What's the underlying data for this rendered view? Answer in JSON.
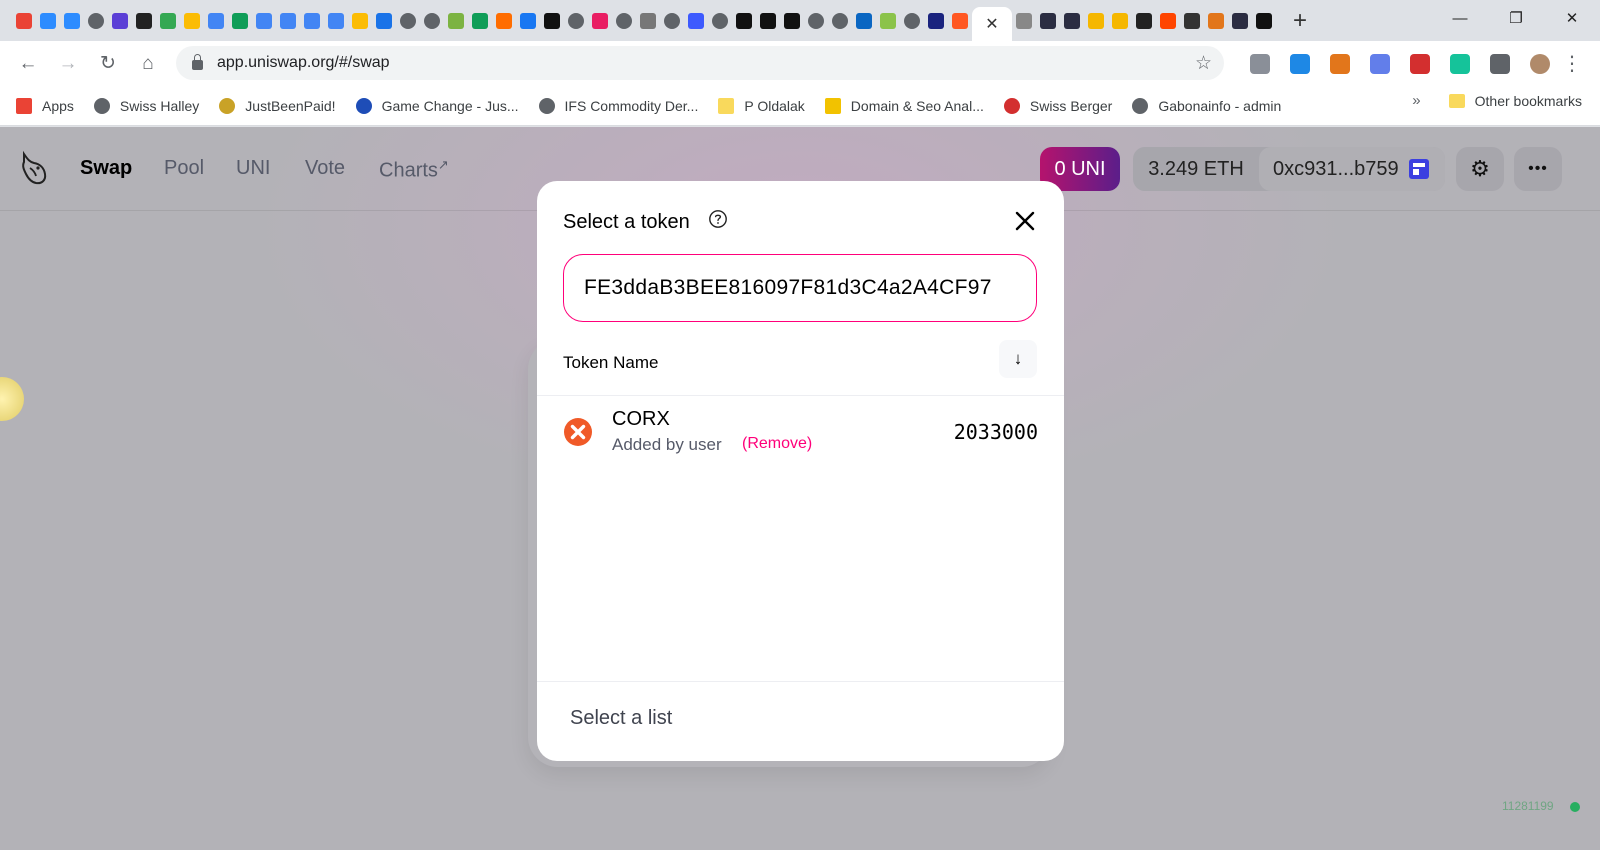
{
  "browser": {
    "tabs": {
      "favicon_colors": [
        "#ea4335",
        "#2d8cff",
        "#2d8cff",
        "#5f6368",
        "#5b3fd6",
        "#222222",
        "#34a853",
        "#fbbc04",
        "#4285f4",
        "#0f9d58",
        "#4285f4",
        "#4285f4",
        "#4285f4",
        "#4285f4",
        "#fbbc04",
        "#1a73e8",
        "#5f6368",
        "#5f6368",
        "#7cb342",
        "#0f9d58",
        "#ff6d00",
        "#1877f2",
        "#111111",
        "#5f6368",
        "#e91e63",
        "#5f6368",
        "#777777",
        "#5f6368",
        "#3d5afe",
        "#5f6368",
        "#111111",
        "#111111",
        "#111111",
        "#5f6368",
        "#5f6368",
        "#0a66c2",
        "#8bc34a",
        "#5f6368",
        "#1a237e",
        "#ff5722"
      ],
      "active_close": "✕",
      "after_colors": [
        "#888888",
        "#2b2d42",
        "#2b2d42",
        "#f5b700",
        "#f5b700",
        "#222222",
        "#ff4500",
        "#333333",
        "#e2761b",
        "#2b2d42",
        "#111111"
      ],
      "new_tab": "+"
    },
    "window": {
      "minimize": "—",
      "restore": "❐",
      "close": "✕"
    },
    "nav": {
      "back": "←",
      "forward": "→",
      "reload": "↻",
      "home": "⌂"
    },
    "url": "app.uniswap.org/#/swap",
    "star": "☆",
    "extensions": [
      "#8a8f98",
      "#1e88e5",
      "#e2761b",
      "#627eea",
      "#d32f2f",
      "#15c39a",
      "#5f6368",
      "#b08a6a"
    ],
    "menu": "⋮",
    "bookmarks": [
      {
        "label": "Apps",
        "color": "#ea4335",
        "square": true
      },
      {
        "label": "Swiss Halley",
        "color": "#5f6368",
        "square": false
      },
      {
        "label": "JustBeenPaid!",
        "color": "#c9a227",
        "square": false
      },
      {
        "label": "Game Change - Jus...",
        "color": "#1e4db7",
        "square": false
      },
      {
        "label": "IFS Commodity Der...",
        "color": "#5f6368",
        "square": false
      },
      {
        "label": "P Oldalak",
        "color": "#f9d95c",
        "square": true
      },
      {
        "label": "Domain & Seo Anal...",
        "color": "#f2c200",
        "square": true
      },
      {
        "label": "Swiss Berger",
        "color": "#d32f2f",
        "square": false
      },
      {
        "label": "Gabonainfo - admin",
        "color": "#5f6368",
        "square": false
      }
    ],
    "bookmarks_overflow": "»",
    "other_bookmarks": "Other bookmarks"
  },
  "app": {
    "nav": [
      {
        "label": "Swap",
        "active": true
      },
      {
        "label": "Pool",
        "active": false
      },
      {
        "label": "UNI",
        "active": false
      },
      {
        "label": "Vote",
        "active": false
      },
      {
        "label": "Charts",
        "active": false,
        "external": "↗"
      }
    ],
    "uni_balance": "0 UNI",
    "eth_balance": "3.249 ETH",
    "address": "0xc931...b759",
    "settings": "⚙",
    "more": "•••",
    "build_number": "11281199",
    "colors": {
      "pink": "#ff007a",
      "uni_start": "#b5136d",
      "uni_end": "#5b1e8a"
    }
  },
  "modal": {
    "title": "Select a token",
    "search_value": "FE3ddaB3BEE816097F81d3C4a2A4CF97",
    "sort_label": "Token Name",
    "sort_arrow": "↓",
    "token": {
      "symbol": "CORX",
      "added_by": "Added by user",
      "remove": "(Remove)",
      "balance": "2033000",
      "logo_color": "#f05a28"
    },
    "footer": "Select a list"
  }
}
